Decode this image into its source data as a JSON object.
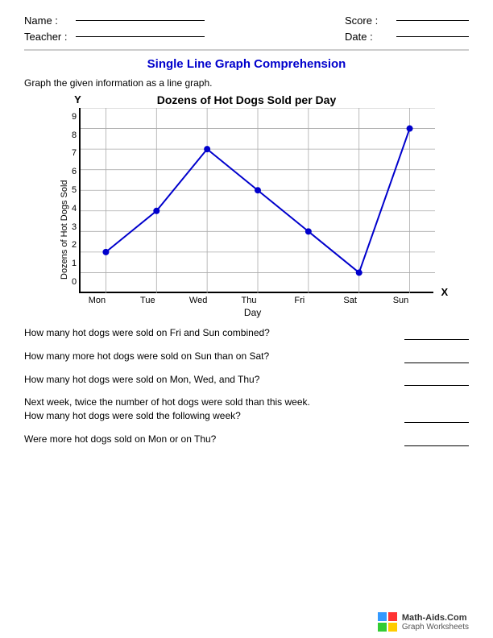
{
  "header": {
    "name_label": "Name :",
    "teacher_label": "Teacher :",
    "score_label": "Score :",
    "date_label": "Date :"
  },
  "title": "Single Line Graph Comprehension",
  "instruction": "Graph the given information as a line graph.",
  "graph": {
    "title": "Dozens of Hot Dogs Sold per Day",
    "y_axis_label": "Dozens of Hot Dogs Sold",
    "x_axis_label": "Day",
    "y_axis_letter": "Y",
    "x_axis_letter": "X",
    "y_values": [
      "0",
      "1",
      "2",
      "3",
      "4",
      "5",
      "6",
      "7",
      "8",
      "9"
    ],
    "x_labels": [
      "Mon",
      "Tue",
      "Wed",
      "Thu",
      "Fri",
      "Sat",
      "Sun"
    ],
    "data_points": [
      {
        "day": "Mon",
        "value": 2
      },
      {
        "day": "Tue",
        "value": 4
      },
      {
        "day": "Wed",
        "value": 7
      },
      {
        "day": "Thu",
        "value": 5
      },
      {
        "day": "Fri",
        "value": 3
      },
      {
        "day": "Sat",
        "value": 1
      },
      {
        "day": "Sun",
        "value": 8
      }
    ]
  },
  "questions": [
    {
      "id": "q1",
      "text": "How many hot dogs were sold on Fri and Sun combined?"
    },
    {
      "id": "q2",
      "text": "How many more hot dogs were sold on Sun than on Sat?"
    },
    {
      "id": "q3",
      "text": "How many hot dogs were sold on Mon, Wed, and Thu?"
    },
    {
      "id": "q4",
      "text": "Next week, twice the number of hot dogs were sold than this week.\nHow many hot dogs were sold the following week?"
    },
    {
      "id": "q5",
      "text": "Were more hot dogs sold on Mon or on Thu?"
    }
  ],
  "footer": {
    "site": "Math-Aids.Com",
    "subtitle": "Graph Worksheets"
  }
}
